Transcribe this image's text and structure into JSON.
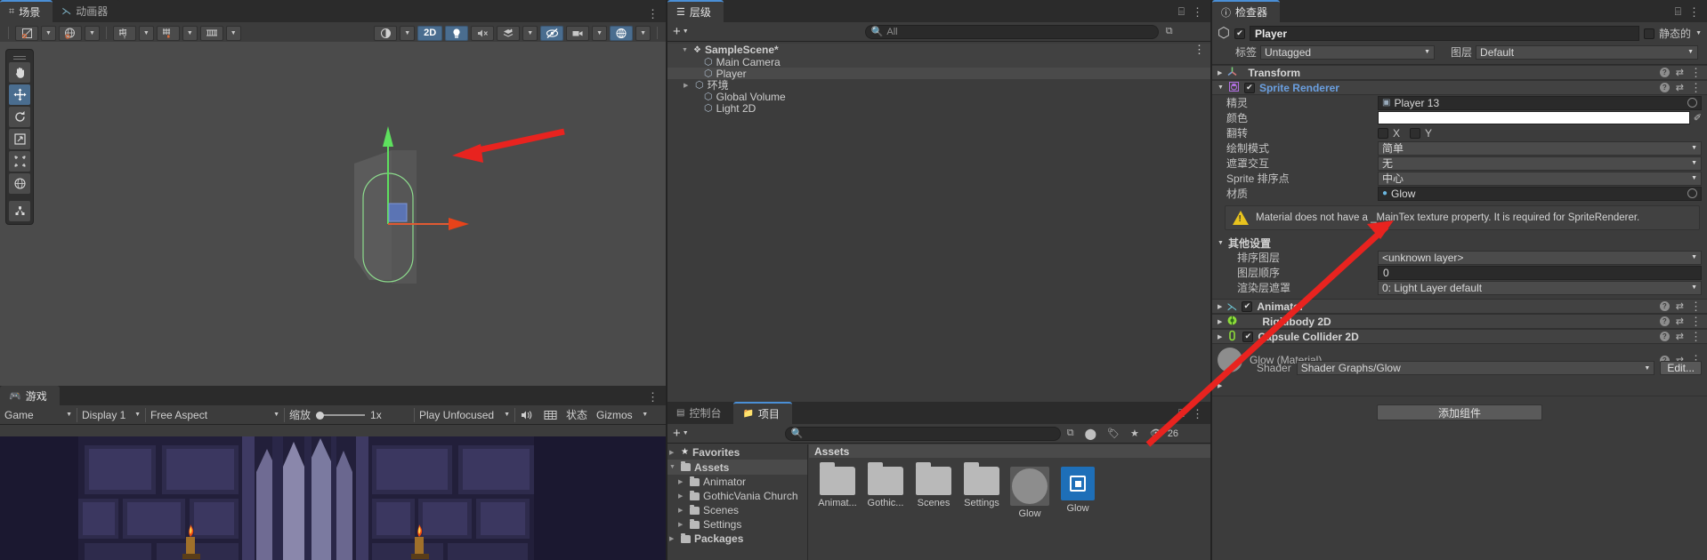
{
  "scene_panel": {
    "tabs": [
      {
        "label": "场景",
        "icon": "grid-icon",
        "active": true
      },
      {
        "label": "动画器",
        "icon": "animator-icon",
        "active": false
      }
    ],
    "toolbar": {
      "pivot_mode": "Center",
      "pivot_rotation": "Global",
      "grid_visibility": "grid-y-icon",
      "grid_snapping": "grid-snap-icon",
      "snap_increment": "snap-increment-icon",
      "shading_mode": "Shaded",
      "two_d_label": "2D",
      "lighting": "light-icon",
      "audio": "audio-mute-icon",
      "fx": "effects-icon",
      "hidden_objects": "visibility-off-icon",
      "camera": "camera-icon",
      "gizmos": "gizmos-icon"
    },
    "tools": [
      {
        "name": "hand-tool",
        "glyph": "✋",
        "active": false
      },
      {
        "name": "move-tool",
        "glyph": "✥",
        "active": true
      },
      {
        "name": "rotate-tool",
        "glyph": "↺",
        "active": false
      },
      {
        "name": "scale-tool",
        "glyph": "⤢",
        "active": false
      },
      {
        "name": "rect-tool",
        "glyph": "⬚",
        "active": false
      },
      {
        "name": "transform-tool",
        "glyph": "◍",
        "active": false
      },
      {
        "name": "custom-tool",
        "glyph": "⚙",
        "active": false
      }
    ]
  },
  "game_panel": {
    "tab": {
      "label": "游戏",
      "icon": "gamepad-icon"
    },
    "toolbar": {
      "play_target": "Game",
      "display": "Display 1",
      "aspect": "Free Aspect",
      "scale_label": "缩放",
      "scale_value": "1x",
      "play_mode": "Play Unfocused",
      "mute_icon": "speaker-icon",
      "stats_icon": "stats-icon",
      "stats_label": "状态",
      "gizmos_label": "Gizmos"
    }
  },
  "hierarchy": {
    "tab": {
      "label": "层级",
      "icon": "hierarchy-icon"
    },
    "add_label": "+",
    "search_placeholder": "All",
    "items": [
      {
        "label": "SampleScene*",
        "depth": 0,
        "icon": "scene-icon",
        "expanded": true,
        "bold": true,
        "selected": false
      },
      {
        "label": "Main Camera",
        "depth": 1,
        "icon": "gameobject-icon",
        "expanded": null,
        "bold": false,
        "selected": false
      },
      {
        "label": "Player",
        "depth": 1,
        "icon": "gameobject-icon",
        "expanded": null,
        "bold": false,
        "selected": true
      },
      {
        "label": "环境",
        "depth": 1,
        "icon": "gameobject-icon",
        "expanded": false,
        "bold": false,
        "selected": false
      },
      {
        "label": "Global Volume",
        "depth": 1,
        "icon": "gameobject-icon",
        "expanded": null,
        "bold": false,
        "selected": false
      },
      {
        "label": "Light 2D",
        "depth": 1,
        "icon": "gameobject-icon",
        "expanded": null,
        "bold": false,
        "selected": false
      }
    ]
  },
  "project": {
    "tabs": [
      {
        "label": "控制台",
        "icon": "console-icon",
        "active": false
      },
      {
        "label": "项目",
        "icon": "folder-icon",
        "active": true
      }
    ],
    "add_label": "+",
    "search_placeholder": "",
    "hidden_count": "26",
    "tree": [
      {
        "label": "Favorites",
        "depth": 0,
        "icon": "star-icon",
        "expanded": false,
        "bold": true,
        "selected": false
      },
      {
        "label": "Assets",
        "depth": 0,
        "icon": "folder-open-icon",
        "expanded": true,
        "bold": true,
        "selected": true
      },
      {
        "label": "Animator",
        "depth": 1,
        "icon": "folder-icon",
        "expanded": false,
        "bold": false,
        "selected": false
      },
      {
        "label": "GothicVania Church",
        "depth": 1,
        "icon": "folder-icon",
        "expanded": false,
        "bold": false,
        "selected": false
      },
      {
        "label": "Scenes",
        "depth": 1,
        "icon": "folder-icon",
        "expanded": false,
        "bold": false,
        "selected": false
      },
      {
        "label": "Settings",
        "depth": 1,
        "icon": "folder-icon",
        "expanded": false,
        "bold": false,
        "selected": false
      },
      {
        "label": "Packages",
        "depth": 0,
        "icon": "folder-icon",
        "expanded": false,
        "bold": true,
        "selected": false
      }
    ],
    "breadcrumb": "Assets",
    "grid_items": [
      {
        "label": "Animat...",
        "kind": "folder",
        "selected": false
      },
      {
        "label": "Gothic...",
        "kind": "folder",
        "selected": false
      },
      {
        "label": "Scenes",
        "kind": "folder",
        "selected": false
      },
      {
        "label": "Settings",
        "kind": "folder",
        "selected": false
      },
      {
        "label": "Glow",
        "kind": "material",
        "selected": true
      },
      {
        "label": "Glow",
        "kind": "shader",
        "selected": false
      }
    ]
  },
  "inspector": {
    "tab": {
      "label": "检查器",
      "icon": "info-icon"
    },
    "object_name": "Player",
    "enabled": true,
    "static_label": "静态的",
    "static_checked": false,
    "tag_label": "标签",
    "tag_value": "Untagged",
    "layer_label": "图层",
    "layer_value": "Default",
    "components": [
      {
        "name": "Transform",
        "expanded": false,
        "has_checkbox": false,
        "icon": "transform-icon"
      },
      {
        "name": "Sprite Renderer",
        "expanded": true,
        "has_checkbox": true,
        "checked": true,
        "icon": "sprite-renderer-icon",
        "highlighted": true
      },
      {
        "name": "Animator",
        "expanded": false,
        "has_checkbox": true,
        "checked": true,
        "icon": "animator-icon"
      },
      {
        "name": "Rigidbody 2D",
        "expanded": false,
        "has_checkbox": false,
        "icon": "rigidbody2d-icon"
      },
      {
        "name": "Capsule Collider 2D",
        "expanded": false,
        "has_checkbox": true,
        "checked": true,
        "icon": "capsule-collider-icon"
      }
    ],
    "sprite_renderer": {
      "sprite_label": "精灵",
      "sprite_value": "Player 13",
      "color_label": "颜色",
      "color_value": "#FFFFFF",
      "flip_label": "翻转",
      "flip_x_label": "X",
      "flip_y_label": "Y",
      "flip_x": false,
      "flip_y": false,
      "draw_mode_label": "绘制模式",
      "draw_mode_value": "简单",
      "mask_interaction_label": "遮罩交互",
      "mask_interaction_value": "无",
      "sprite_sort_point_label": "Sprite 排序点",
      "sprite_sort_point_value": "中心",
      "material_label": "材质",
      "material_value": "Glow",
      "warning": "Material does not have a _MainTex texture property. It is required for SpriteRenderer.",
      "additional_settings_label": "其他设置",
      "sorting_layer_label": "排序图层",
      "sorting_layer_value": "<unknown layer>",
      "order_in_layer_label": "图层顺序",
      "order_in_layer_value": "0",
      "rendering_layer_mask_label": "渲染层遮罩",
      "rendering_layer_mask_value": "0: Light Layer default"
    },
    "material_preview": {
      "title": "Glow (Material)",
      "shader_label": "Shader",
      "shader_value": "Shader Graphs/Glow",
      "edit_label": "Edit..."
    },
    "add_component_label": "添加组件"
  },
  "colors": {
    "accent_blue": "#4a8fd6",
    "panel_bg": "#3c3c3c",
    "tab_bg": "#2b2b2b",
    "highlight": "#4a6d8f",
    "annotation_red": "#e8231f",
    "warning_yellow": "#e8c31e",
    "component_blue": "#6a9fe0"
  }
}
